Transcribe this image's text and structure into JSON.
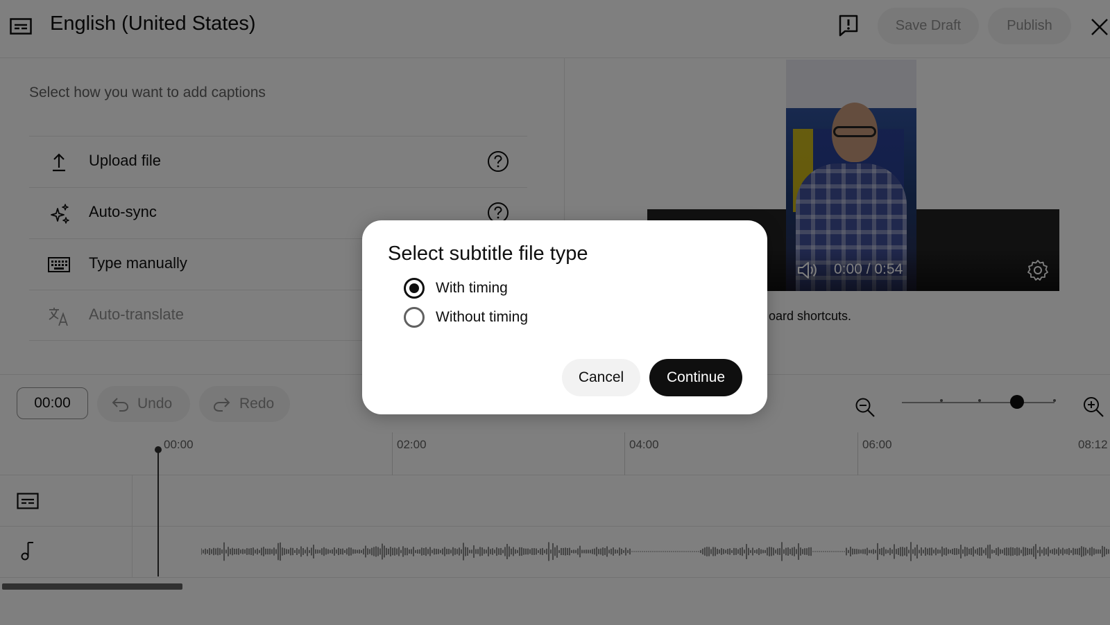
{
  "header": {
    "title": "English (United States)",
    "save_draft_label": "Save Draft",
    "publish_label": "Publish"
  },
  "left_panel": {
    "prompt": "Select how you want to add captions",
    "options": [
      {
        "label": "Upload file",
        "icon": "upload-icon"
      },
      {
        "label": "Auto-sync",
        "icon": "sparkle-icon"
      },
      {
        "label": "Type manually",
        "icon": "keyboard-icon"
      },
      {
        "label": "Auto-translate",
        "icon": "translate-icon"
      }
    ]
  },
  "video": {
    "time": "0:00 / 0:54",
    "shortcuts_text": "oard shortcuts."
  },
  "toolbar": {
    "time_value": "00:00",
    "undo_label": "Undo",
    "redo_label": "Redo"
  },
  "timeline": {
    "ticks": [
      "00:00",
      "02:00",
      "04:00",
      "06:00",
      "08:12"
    ]
  },
  "dialog": {
    "title": "Select subtitle file type",
    "options": [
      {
        "label": "With timing",
        "selected": true
      },
      {
        "label": "Without timing",
        "selected": false
      }
    ],
    "cancel_label": "Cancel",
    "continue_label": "Continue"
  },
  "colors": {
    "text": "#0f0f0f",
    "muted": "#606060",
    "disabled": "#909090",
    "pill_bg": "#f2f2f2",
    "primary_button": "#0f0f0f"
  }
}
